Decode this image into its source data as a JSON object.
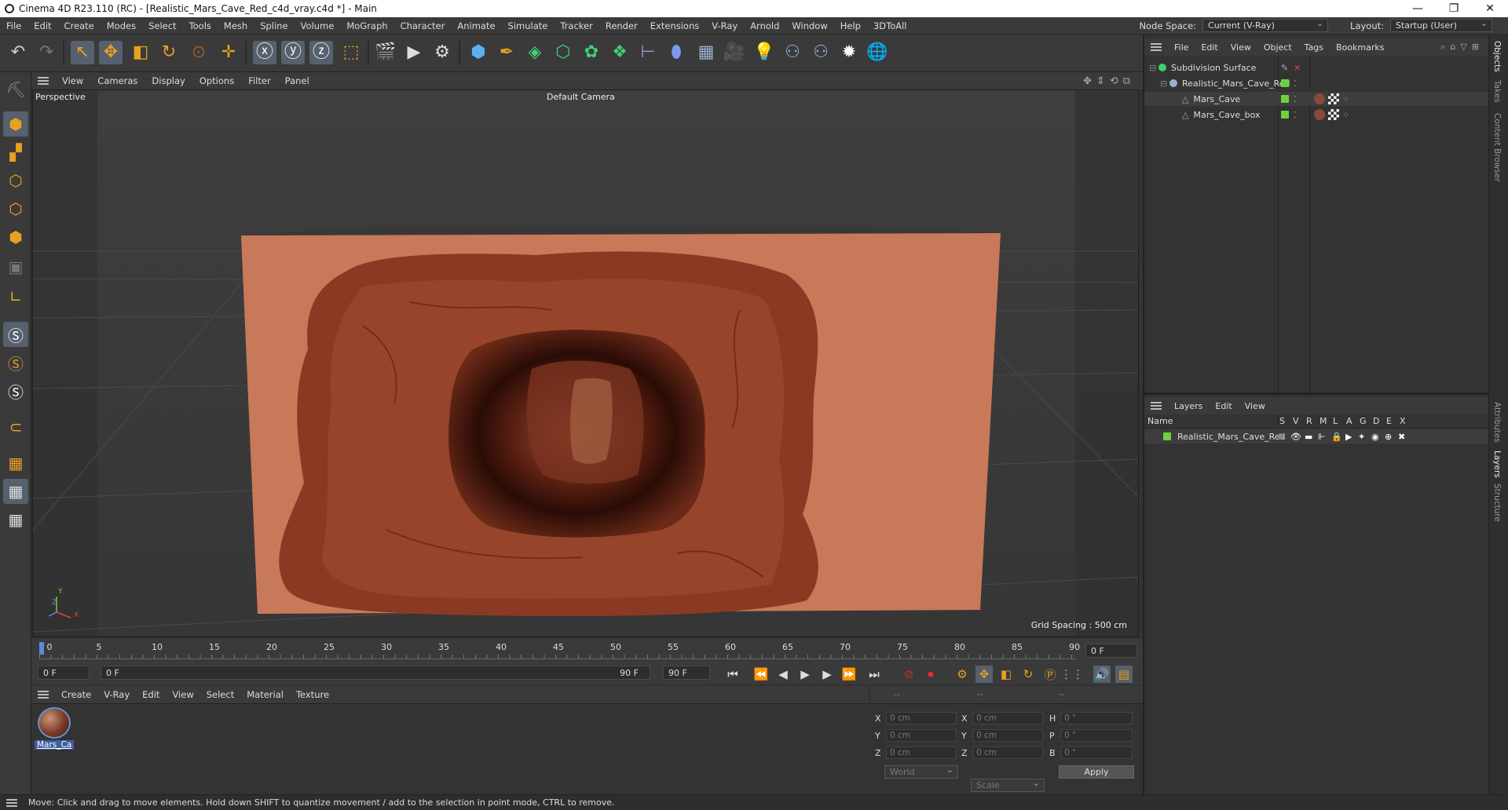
{
  "window": {
    "title": "Cinema 4D R23.110 (RC) - [Realistic_Mars_Cave_Red_c4d_vray.c4d *] - Main",
    "controls": [
      "—",
      "❐",
      "✕"
    ]
  },
  "menubar": {
    "items": [
      "File",
      "Edit",
      "Create",
      "Modes",
      "Select",
      "Tools",
      "Mesh",
      "Spline",
      "Volume",
      "MoGraph",
      "Character",
      "Animate",
      "Simulate",
      "Tracker",
      "Render",
      "Extensions",
      "V-Ray",
      "Arnold",
      "Window",
      "Help",
      "3DToAll"
    ],
    "node_space_label": "Node Space:",
    "node_space_value": "Current (V-Ray)",
    "layout_label": "Layout:",
    "layout_value": "Startup (User)"
  },
  "toolbar": {
    "icons": [
      "undo-icon",
      "redo-icon",
      "select-icon",
      "move-icon",
      "scale-icon",
      "rotate-icon",
      "recent-tool-icon",
      "snap-icon",
      "x-axis-icon",
      "y-axis-icon",
      "z-axis-icon",
      "coordinate-system-icon",
      "render-region-icon",
      "render-view-icon",
      "render-settings-icon",
      "cube-icon",
      "pen-icon",
      "subdivision-icon",
      "extrude-icon",
      "cloner-icon",
      "mograph-icon",
      "symmetry-icon",
      "deformer-icon",
      "floor-icon",
      "camera-icon",
      "light-icon",
      "python-icon",
      "python2-icon",
      "gear-icon",
      "globe-icon"
    ]
  },
  "viewport": {
    "menu": [
      "View",
      "Cameras",
      "Display",
      "Options",
      "Filter",
      "Panel"
    ],
    "title": "Perspective",
    "camera": "Default Camera",
    "grid_spacing": "Grid Spacing : 500 cm",
    "axis_labels": [
      "Y",
      "Z",
      "X"
    ]
  },
  "timeline": {
    "ticks": [
      "0",
      "5",
      "10",
      "15",
      "20",
      "25",
      "30",
      "35",
      "40",
      "45",
      "50",
      "55",
      "60",
      "65",
      "70",
      "75",
      "80",
      "85",
      "90"
    ],
    "current_frame": "0 F",
    "start_frame": "0 F",
    "range_start": "0 F",
    "range_end": "90 F",
    "end_frame": "90 F",
    "right_frame": "0 F"
  },
  "material_manager": {
    "menu": [
      "Create",
      "V-Ray",
      "Edit",
      "View",
      "Select",
      "Material",
      "Texture"
    ],
    "materials": [
      {
        "name": "Mars_Ca"
      }
    ]
  },
  "coordinates": {
    "header": [
      "--",
      "--",
      "--"
    ],
    "rows": [
      {
        "a": "X",
        "av": "0 cm",
        "b": "X",
        "bv": "0 cm",
        "c": "H",
        "cv": "0 °"
      },
      {
        "a": "Y",
        "av": "0 cm",
        "b": "Y",
        "bv": "0 cm",
        "c": "P",
        "cv": "0 °"
      },
      {
        "a": "Z",
        "av": "0 cm",
        "b": "Z",
        "bv": "0 cm",
        "c": "B",
        "cv": "0 °"
      }
    ],
    "mode": "World",
    "size_mode": "Scale",
    "apply": "Apply"
  },
  "objects_panel": {
    "menu": [
      "File",
      "Edit",
      "View",
      "Object",
      "Tags",
      "Bookmarks"
    ],
    "items": [
      {
        "name": "Subdivision Surface",
        "indent": 0
      },
      {
        "name": "Realistic_Mars_Cave_Red",
        "indent": 1
      },
      {
        "name": "Mars_Cave",
        "indent": 2
      },
      {
        "name": "Mars_Cave_box",
        "indent": 2
      }
    ]
  },
  "layers_panel": {
    "menu": [
      "Layers",
      "Edit",
      "View"
    ],
    "columns": [
      "Name",
      "S",
      "V",
      "R",
      "M",
      "L",
      "A",
      "G",
      "D",
      "E",
      "X"
    ],
    "rows": [
      {
        "name": "Realistic_Mars_Cave_Red"
      }
    ]
  },
  "side_tabs": [
    "Objects",
    "Takes",
    "Content Browser",
    "Attributes",
    "Layers",
    "Structure"
  ],
  "status": "Move: Click and drag to move elements. Hold down SHIFT to quantize movement / add to the selection in point mode, CTRL to remove.",
  "colors": {
    "accent": "#56606e",
    "layer_green": "#6fcf3f",
    "cave_face": "#c8795a",
    "cave_rock": "#8a3a22"
  }
}
